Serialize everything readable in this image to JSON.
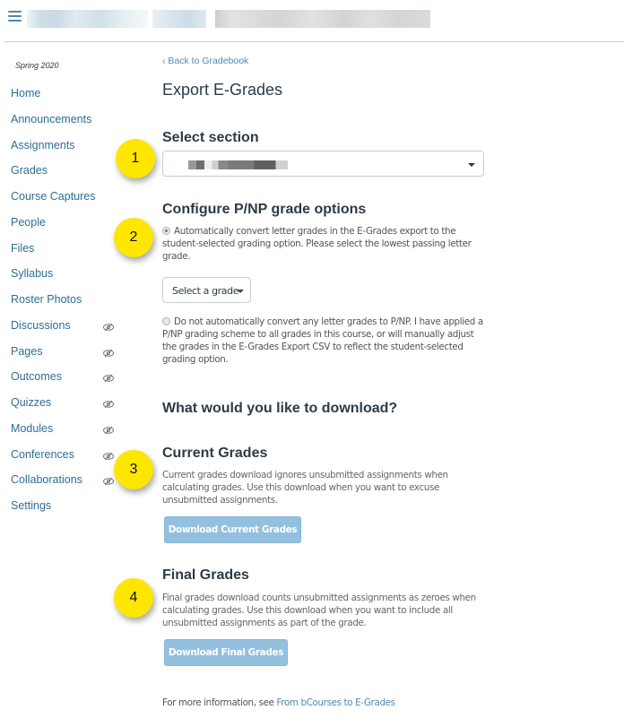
{
  "topbar": {
    "menu_icon": "hamburger-icon",
    "breadcrumb_redacted": true
  },
  "sidebar": {
    "term": "Spring 2020",
    "items": [
      {
        "label": "Home",
        "hidden": false
      },
      {
        "label": "Announcements",
        "hidden": false
      },
      {
        "label": "Assignments",
        "hidden": false
      },
      {
        "label": "Grades",
        "hidden": false
      },
      {
        "label": "Course Captures",
        "hidden": false
      },
      {
        "label": "People",
        "hidden": false
      },
      {
        "label": "Files",
        "hidden": false
      },
      {
        "label": "Syllabus",
        "hidden": false
      },
      {
        "label": "Roster Photos",
        "hidden": false
      },
      {
        "label": "Discussions",
        "hidden": true
      },
      {
        "label": "Pages",
        "hidden": true
      },
      {
        "label": "Outcomes",
        "hidden": true
      },
      {
        "label": "Quizzes",
        "hidden": true
      },
      {
        "label": "Modules",
        "hidden": true
      },
      {
        "label": "Conferences",
        "hidden": true
      },
      {
        "label": "Collaborations",
        "hidden": true
      },
      {
        "label": "Settings",
        "hidden": false
      }
    ],
    "hidden_icon": "eye-slash-icon"
  },
  "main": {
    "back_link": "‹ Back to Gradebook",
    "title": "Export E-Grades",
    "select_section": {
      "heading": "Select section",
      "value_redacted": true
    },
    "pnp": {
      "heading": "Configure P/NP grade options",
      "option_auto": "Automatically convert letter grades in the E-Grades export to the student-selected grading option. Please select the lowest passing letter grade.",
      "option_auto_checked": true,
      "grade_select_label": "Select a grade",
      "option_manual": "Do not automatically convert any letter grades to P/NP. I have applied a P/NP grading scheme to all grades in this course, or will manually adjust the grades in the E-Grades Export CSV to reflect the student-selected grading option.",
      "option_manual_checked": false
    },
    "download_heading": "What would you like to download?",
    "current": {
      "heading": "Current Grades",
      "description": "Current grades download ignores unsubmitted assignments when calculating grades. Use this download when you want to excuse unsubmitted assignments.",
      "button": "Download Current Grades"
    },
    "final": {
      "heading": "Final Grades",
      "description": "Final grades download counts unsubmitted assignments as zeroes when calculating grades. Use this download when you want to include all unsubmitted assignments as part of the grade.",
      "button": "Download Final Grades"
    },
    "footer_prefix": "For more information, see ",
    "footer_link": "From bCourses to E-Grades"
  },
  "annotations": {
    "badges": [
      "1",
      "2",
      "3",
      "4"
    ],
    "color": "#ffe600"
  },
  "colors": {
    "link": "#2d6e96",
    "button": "#93c0de",
    "text": "#2d3b45"
  }
}
